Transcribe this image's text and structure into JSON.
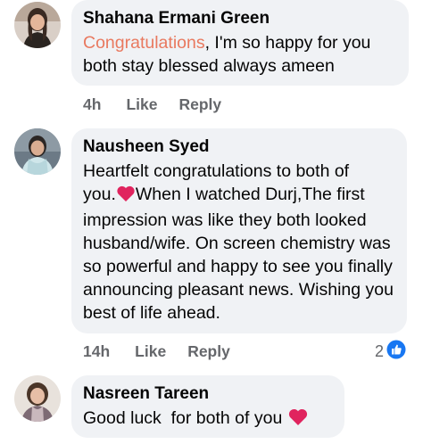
{
  "comments": [
    {
      "author": "Shahana Ermani Green",
      "text_highlight": "Congratulations",
      "text_rest": ", I'm so happy for you both stay blessed always ameen",
      "time": "4h",
      "like_label": "Like",
      "reply_label": "Reply"
    },
    {
      "author": "Nausheen Syed",
      "text_line1": "Heartfelt congratulations to both of",
      "text_line2_pre": "you.",
      "text_line2_post": "When I watched Durj,The first",
      "text_rest": "impression was like they both looked husband/wife. On screen chemistry was so powerful and happy to see you finally announcing pleasant news. Wishing you best of life ahead.",
      "time": "14h",
      "like_label": "Like",
      "reply_label": "Reply",
      "reaction_count": "2",
      "reaction_icon": "thumbs-up-icon"
    },
    {
      "author": "Nasreen Tareen",
      "text": "Good luck  for both of you",
      "emoji": "red-heart"
    }
  ],
  "colors": {
    "bubble": "#f0f2f5",
    "highlight": "#e9795f",
    "meta": "#65676b",
    "like_blue": "#1877f2",
    "heart_red": "#e0245e"
  }
}
